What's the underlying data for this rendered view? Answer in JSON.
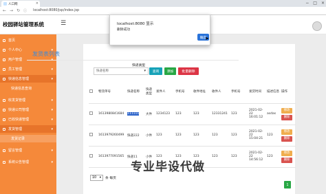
{
  "browser": {
    "tab_title": "人口网",
    "url": "localhost:8080/jsp/index.jsp",
    "win_controls": [
      "−",
      "□",
      "×"
    ]
  },
  "app": {
    "brand": "校园驿站管理系统",
    "menu_icon": "hamburger-icon"
  },
  "sidebar": {
    "items": [
      {
        "label": "首页",
        "icon": "home-icon"
      },
      {
        "label": "个人中心",
        "icon": "user-icon"
      },
      {
        "label": "用户管理",
        "icon": "users-icon"
      },
      {
        "label": "员工管理",
        "icon": "staff-icon"
      },
      {
        "label": "快递信息管理",
        "icon": "box-icon"
      },
      {
        "label": "快递信息查询",
        "icon": "",
        "sub": true
      },
      {
        "label": "收发货管理",
        "icon": "package-icon"
      },
      {
        "label": "快递公司管理",
        "icon": "truck-icon"
      },
      {
        "label": "已收快递管理",
        "icon": "inbox-icon"
      },
      {
        "label": "发货管理",
        "icon": "send-icon"
      },
      {
        "label": "发货记录",
        "icon": "",
        "sub": true
      },
      {
        "label": "留言管理",
        "icon": "message-icon"
      },
      {
        "label": "系统公告管理",
        "icon": "notice-icon"
      }
    ]
  },
  "page": {
    "title": "发货表列表",
    "filter_label": "快递类型",
    "select_placeholder": "快递名称",
    "query_button": "查询",
    "add_button": "添加",
    "batch_delete_button": "批量删除"
  },
  "table": {
    "headers": [
      "",
      "物流单号",
      "快递名称",
      "快递类型",
      "发件人",
      "手机号",
      "收件地址",
      "收件人",
      "手机号",
      "发货时间",
      "描述信息",
      "操作"
    ],
    "rows": [
      {
        "no": "1613980841684",
        "name": "111111",
        "type": "大件",
        "sender": "1234123",
        "phone": "123",
        "addr": "123",
        "recv": "12331241",
        "rphone": "123",
        "time": "2021-02-22 16:01:12",
        "desc": "asdas"
      },
      {
        "no": "1613979260499",
        "name": "快递222",
        "type": "小件",
        "sender": "123",
        "phone": "123",
        "addr": "123",
        "recv": "123",
        "rphone": "123",
        "time": "2021-02-22 15:04:21",
        "desc": "123"
      },
      {
        "no": "1613977091565",
        "name": "快递11",
        "type": "小件",
        "sender": "123",
        "phone": "123",
        "addr": "123",
        "recv": "123",
        "rphone": "123",
        "time": "2021-02-22 14:56:12",
        "desc": "123"
      }
    ],
    "edit_label": "修改",
    "delete_label": "删除"
  },
  "pagination": {
    "page_size": "10",
    "suffix": "条 每页",
    "current_page": "1"
  },
  "watermark": "专业毕设代做",
  "dialog": {
    "title": "localhost:8080 显示",
    "message": "删除成功",
    "ok": "确定"
  }
}
